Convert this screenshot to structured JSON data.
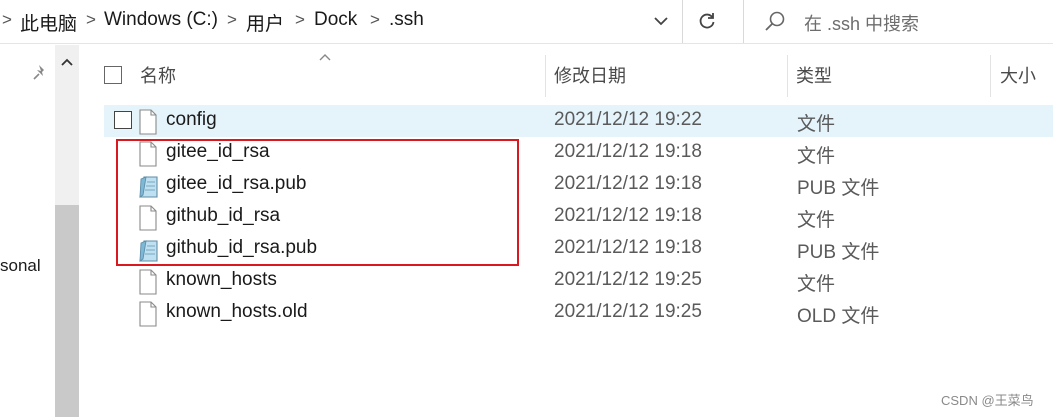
{
  "address_bar": {
    "crumbs": [
      "此电脑",
      "Windows (C:)",
      "用户",
      "Dock",
      ".ssh"
    ],
    "separator": ">",
    "dropdown_icon": "chevron-down-icon",
    "refresh_icon": "refresh-icon"
  },
  "search": {
    "placeholder": "在 .ssh 中搜索",
    "icon": "search-icon"
  },
  "nav_pane": {
    "partial_label": "sonal",
    "pin_icon": "pin-icon"
  },
  "columns": [
    "名称",
    "修改日期",
    "类型",
    "大小"
  ],
  "files": [
    {
      "name": "config",
      "modified": "2021/12/12 19:22",
      "type": "文件",
      "icon": "blank-file-icon",
      "selected": true
    },
    {
      "name": "gitee_id_rsa",
      "modified": "2021/12/12 19:18",
      "type": "文件",
      "icon": "blank-file-icon"
    },
    {
      "name": "gitee_id_rsa.pub",
      "modified": "2021/12/12 19:18",
      "type": "PUB 文件",
      "icon": "pub-file-icon"
    },
    {
      "name": "github_id_rsa",
      "modified": "2021/12/12 19:18",
      "type": "文件",
      "icon": "blank-file-icon"
    },
    {
      "name": "github_id_rsa.pub",
      "modified": "2021/12/12 19:18",
      "type": "PUB 文件",
      "icon": "pub-file-icon"
    },
    {
      "name": "known_hosts",
      "modified": "2021/12/12 19:25",
      "type": "文件",
      "icon": "blank-file-icon"
    },
    {
      "name": "known_hosts.old",
      "modified": "2021/12/12 19:25",
      "type": "OLD 文件",
      "icon": "blank-file-icon"
    }
  ],
  "watermark": "CSDN @王菜鸟",
  "colors": {
    "selected_row": "#e5f3fb",
    "highlight_border": "#d9191f"
  }
}
